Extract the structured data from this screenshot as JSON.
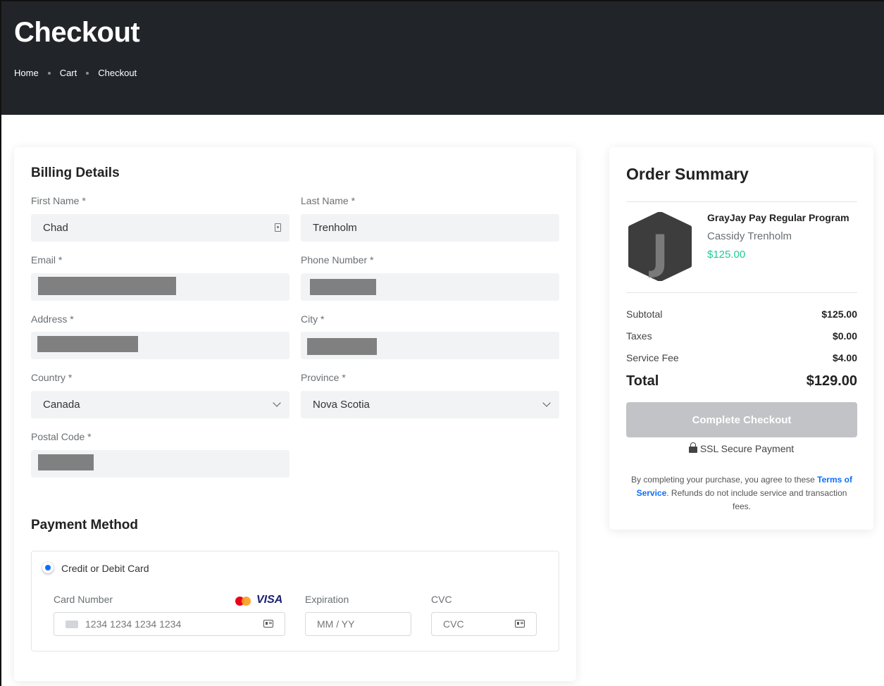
{
  "header": {
    "title": "Checkout",
    "breadcrumbs": [
      "Home",
      "Cart",
      "Checkout"
    ]
  },
  "billing": {
    "title": "Billing Details",
    "first_name": {
      "label": "First Name *",
      "value": "Chad"
    },
    "last_name": {
      "label": "Last Name *",
      "value": "Trenholm"
    },
    "email": {
      "label": "Email *"
    },
    "phone": {
      "label": "Phone Number *"
    },
    "address": {
      "label": "Address *"
    },
    "city": {
      "label": "City *"
    },
    "country": {
      "label": "Country *",
      "value": "Canada"
    },
    "province": {
      "label": "Province *",
      "value": "Nova Scotia"
    },
    "postal": {
      "label": "Postal Code *"
    }
  },
  "payment": {
    "title": "Payment Method",
    "option_label": "Credit or Debit Card",
    "card_number": {
      "label": "Card Number",
      "placeholder": "1234 1234 1234 1234"
    },
    "expiration": {
      "label": "Expiration",
      "placeholder": "MM / YY"
    },
    "cvc": {
      "label": "CVC",
      "placeholder": "CVC"
    },
    "brand_text": "VISA",
    "colors": {
      "mastercard_red": "#eb001b",
      "mastercard_orange": "#f79e1b",
      "radio_selected": "#0d6efd"
    }
  },
  "summary": {
    "title": "Order Summary",
    "product": {
      "logo_letter": "J",
      "name": "GrayJay Pay Regular Program",
      "person": "Cassidy Trenholm",
      "price": "$125.00"
    },
    "subtotal": {
      "label": "Subtotal",
      "value": "$125.00"
    },
    "taxes": {
      "label": "Taxes",
      "value": "$0.00"
    },
    "service_fee": {
      "label": "Service Fee",
      "value": "$4.00"
    },
    "total": {
      "label": "Total",
      "value": "$129.00"
    },
    "button_label": "Complete Checkout",
    "secure_label": "SSL Secure Payment",
    "legal": {
      "prefix": "By completing your purchase, you agree to these ",
      "link": "Terms of Service",
      "suffix": ". Refunds do not include service and transaction fees."
    }
  }
}
